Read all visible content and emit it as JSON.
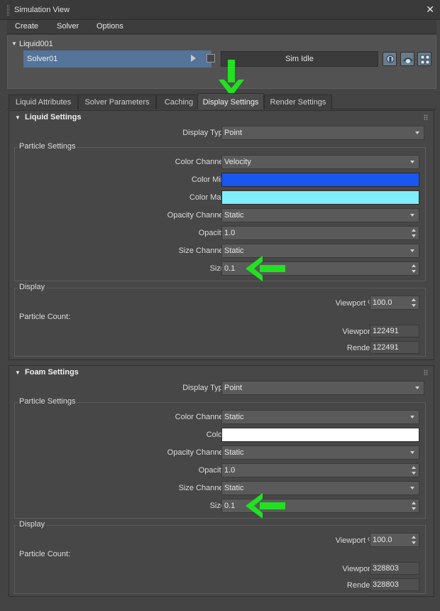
{
  "window": {
    "title": "Simulation View"
  },
  "menu": [
    "Create",
    "Solver",
    "Options"
  ],
  "tree": {
    "root": "Liquid001",
    "solver": "Solver01",
    "status": "Sim Idle"
  },
  "tabs": [
    "Liquid Attributes",
    "Solver Parameters",
    "Caching",
    "Display Settings",
    "Render Settings"
  ],
  "active_tab": "Display Settings",
  "colors": {
    "liquid_color_min": "#1a56f2",
    "liquid_color_max": "#80eefa",
    "foam_color": "#ffffff",
    "annotation_arrow": "#22e022"
  },
  "liquid": {
    "title": "Liquid Settings",
    "display_type_label": "Display Type",
    "display_type": "Point",
    "particle_group": "Particle Settings",
    "color_channel_label": "Color Channel",
    "color_channel": "Velocity",
    "color_min_label": "Color Min",
    "color_max_label": "Color Max",
    "opacity_channel_label": "Opacity Channel",
    "opacity_channel": "Static",
    "opacity_label": "Opacity",
    "opacity": "1.0",
    "size_channel_label": "Size Channel",
    "size_channel": "Static",
    "size_label": "Size",
    "size": "0.1",
    "display_group": "Display",
    "viewport_pct_label": "Viewport %",
    "viewport_pct": "100.0",
    "particle_count_label": "Particle Count:",
    "viewport_label": "Viewport",
    "viewport_count": "122491",
    "render_label": "Render",
    "render_count": "122491"
  },
  "foam": {
    "title": "Foam Settings",
    "display_type_label": "Display Type",
    "display_type": "Point",
    "particle_group": "Particle Settings",
    "color_channel_label": "Color Channel",
    "color_channel": "Static",
    "color_label": "Color",
    "opacity_channel_label": "Opacity Channel",
    "opacity_channel": "Static",
    "opacity_label": "Opacity",
    "opacity": "1.0",
    "size_channel_label": "Size Channel",
    "size_channel": "Static",
    "size_label": "Size",
    "size": "0.1",
    "display_group": "Display",
    "viewport_pct_label": "Viewport %",
    "viewport_pct": "100.0",
    "particle_count_label": "Particle Count:",
    "viewport_label": "Viewport",
    "viewport_count": "328803",
    "render_label": "Render",
    "render_count": "328803"
  }
}
